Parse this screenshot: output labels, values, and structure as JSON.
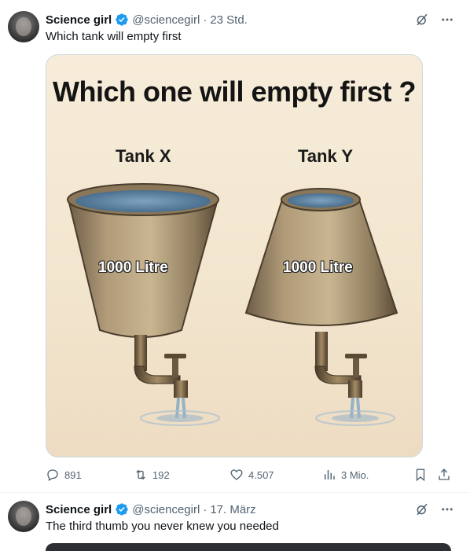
{
  "tweets": [
    {
      "author": "Science girl",
      "handle": "@sciencegirl",
      "time": "23 Std.",
      "text": "Which tank will empty first",
      "image": {
        "title": "Which one will empty first ?",
        "tank_x_label": "Tank X",
        "tank_y_label": "Tank Y",
        "tank_x_volume": "1000 Litre",
        "tank_y_volume": "1000 Litre"
      },
      "actions": {
        "replies": "891",
        "retweets": "192",
        "likes": "4.507",
        "views": "3 Mio."
      }
    },
    {
      "author": "Science girl",
      "handle": "@sciencegirl",
      "time": "17. März",
      "text": "The third thumb you never knew you needed"
    }
  ],
  "colors": {
    "verified": "#1d9bf0",
    "muted": "#536471",
    "border": "#cfd9de"
  },
  "icons": [
    "verified-badge-icon",
    "grok-icon",
    "more-icon",
    "reply-icon",
    "retweet-icon",
    "like-icon",
    "views-icon",
    "bookmark-icon",
    "share-icon"
  ]
}
